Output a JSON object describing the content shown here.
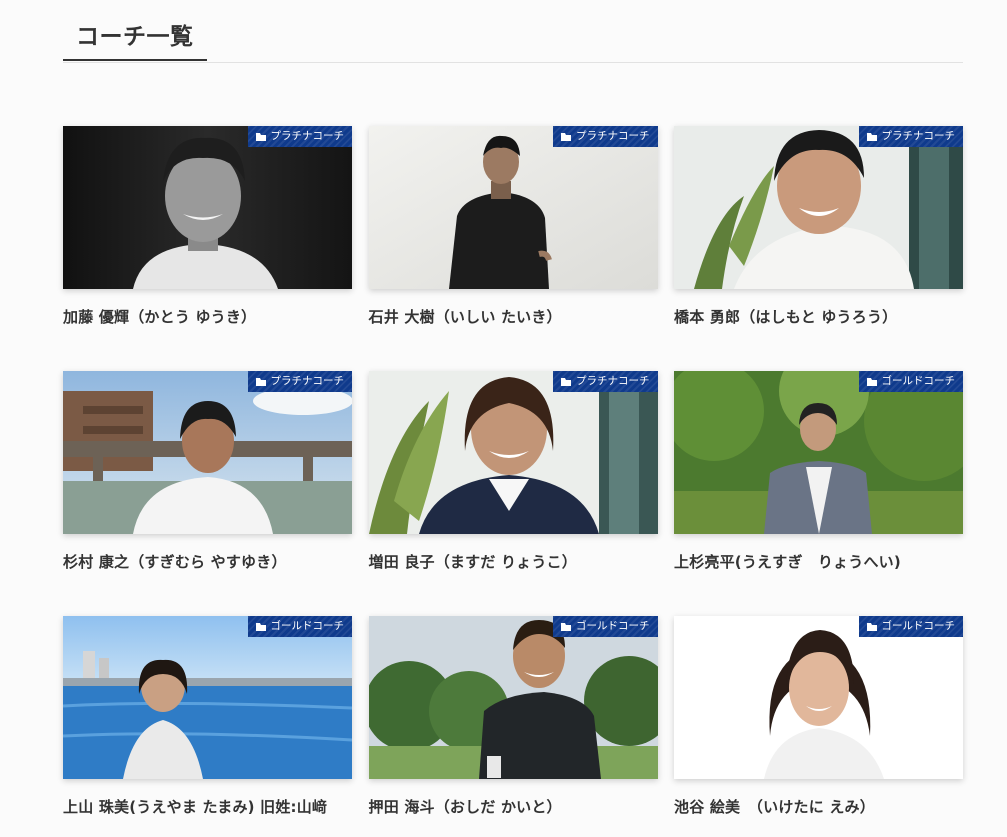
{
  "section": {
    "title": "コーチ一覧"
  },
  "icons": {
    "badge_icon": "folder-icon"
  },
  "colors": {
    "badge_bg": "#0f3a8c",
    "heading_underline": "#333333"
  },
  "coaches": [
    {
      "name": "加藤 優輝（かとう ゆうき）",
      "category": "プラチナコーチ"
    },
    {
      "name": "石井 大樹（いしい たいき）",
      "category": "プラチナコーチ"
    },
    {
      "name": "橋本 勇郎（はしもと ゆうろう）",
      "category": "プラチナコーチ"
    },
    {
      "name": "杉村 康之（すぎむら やすゆき）",
      "category": "プラチナコーチ"
    },
    {
      "name": "増田 良子（ますだ りょうこ）",
      "category": "プラチナコーチ"
    },
    {
      "name": "上杉亮平(うえすぎ　りょうへい)",
      "category": "ゴールドコーチ"
    },
    {
      "name": "上山 珠美(うえやま たまみ) 旧姓:山﨑",
      "category": "ゴールドコーチ"
    },
    {
      "name": "押田 海斗（おしだ かいと）",
      "category": "ゴールドコーチ"
    },
    {
      "name": "池谷 絵美　（いけたに えみ）",
      "category": "ゴールドコーチ"
    }
  ]
}
